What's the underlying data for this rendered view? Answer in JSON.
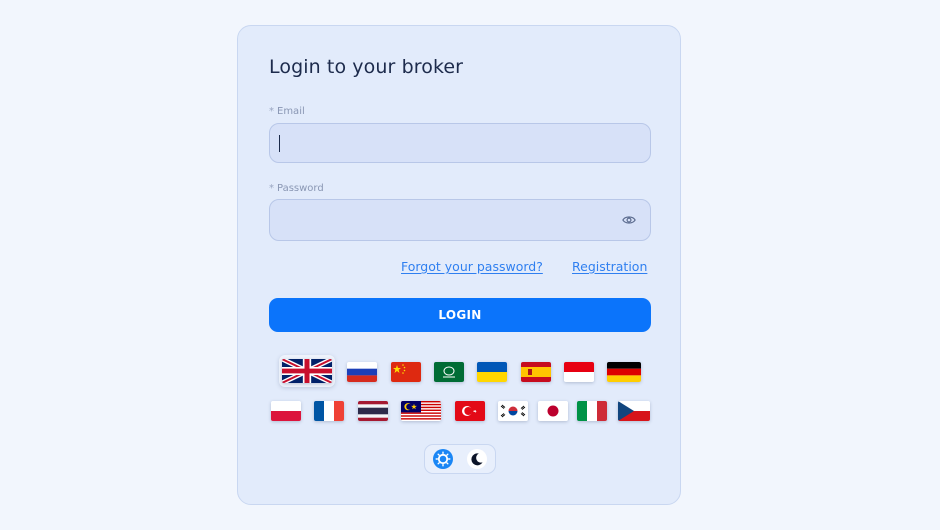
{
  "form": {
    "title": "Login to your broker",
    "email_label": "Email",
    "email_value": "",
    "password_label": "Password",
    "password_value": "",
    "required_marker": "*",
    "forgot_label": "Forgot your password?",
    "registration_label": "Registration",
    "login_label": "LOGIN"
  },
  "languages": [
    "English (UK)",
    "Russian",
    "Chinese",
    "Arabic (Saudi Arabia)",
    "Ukrainian",
    "Spanish",
    "Indonesian",
    "German",
    "Polish",
    "French",
    "Thai",
    "Malay",
    "Turkish",
    "Korean",
    "Japanese",
    "Italian",
    "Czech"
  ],
  "selected_language": "English (UK)",
  "theme": {
    "selected": "light",
    "options": [
      "light",
      "dark"
    ]
  },
  "colors": {
    "accent": "#0b74fb",
    "link": "#2f7ff0",
    "card": "#e2ebfb",
    "background": "#f2f6fd"
  }
}
